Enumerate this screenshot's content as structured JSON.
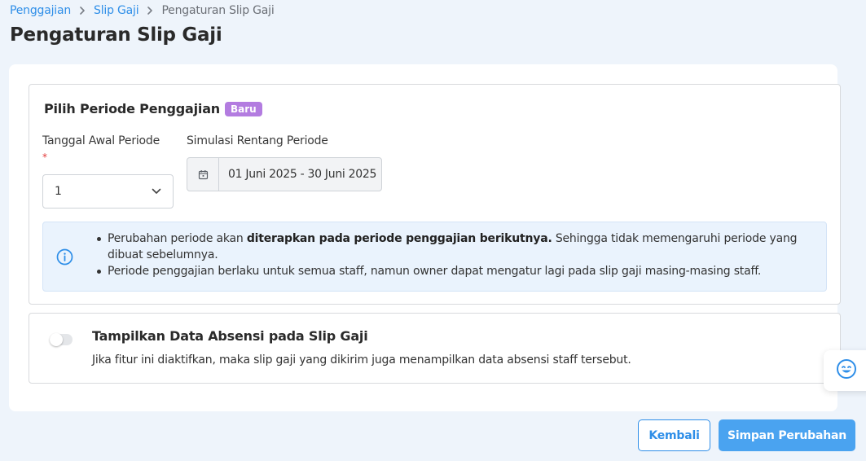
{
  "breadcrumb": {
    "items": [
      "Penggajian",
      "Slip Gaji"
    ],
    "current": "Pengaturan Slip Gaji"
  },
  "page": {
    "title": "Pengaturan Slip Gaji"
  },
  "period_section": {
    "title": "Pilih Periode Penggajian",
    "badge": "Baru",
    "start_label": "Tanggal Awal Periode",
    "required_mark": "*",
    "start_value": "1",
    "range_label": "Simulasi Rentang Periode",
    "range_value": "01 Juni 2025 - 30 Juni 2025",
    "info": {
      "item1_pre": "Perubahan periode akan ",
      "item1_bold": "diterapkan pada periode penggajian berikutnya.",
      "item1_post": " Sehingga tidak memengaruhi periode yang dibuat sebelumnya.",
      "item2": "Periode penggajian berlaku untuk semua staff, namun owner dapat mengatur lagi pada slip gaji masing-masing staff."
    }
  },
  "absensi_section": {
    "title": "Tampilkan Data Absensi pada Slip Gaji",
    "description": "Jika fitur ini diaktifkan, maka slip gaji yang dikirim juga menampilkan data absensi staff tersebut.",
    "enabled": false
  },
  "actions": {
    "back_label": "Kembali",
    "save_label": "Simpan Perubahan"
  },
  "icons": {
    "breadcrumb_separator": "chevron-right-icon",
    "select": "chevron-down-icon",
    "range": "calendar-icon",
    "info": "info-icon",
    "feedback": "smiley-icon"
  },
  "colors": {
    "accent": "#2e8ee8",
    "save_button": "#4aa3f0",
    "badge": "#b37ce0",
    "info_background": "#eaf3fd",
    "page_background": "#eef4fb"
  }
}
